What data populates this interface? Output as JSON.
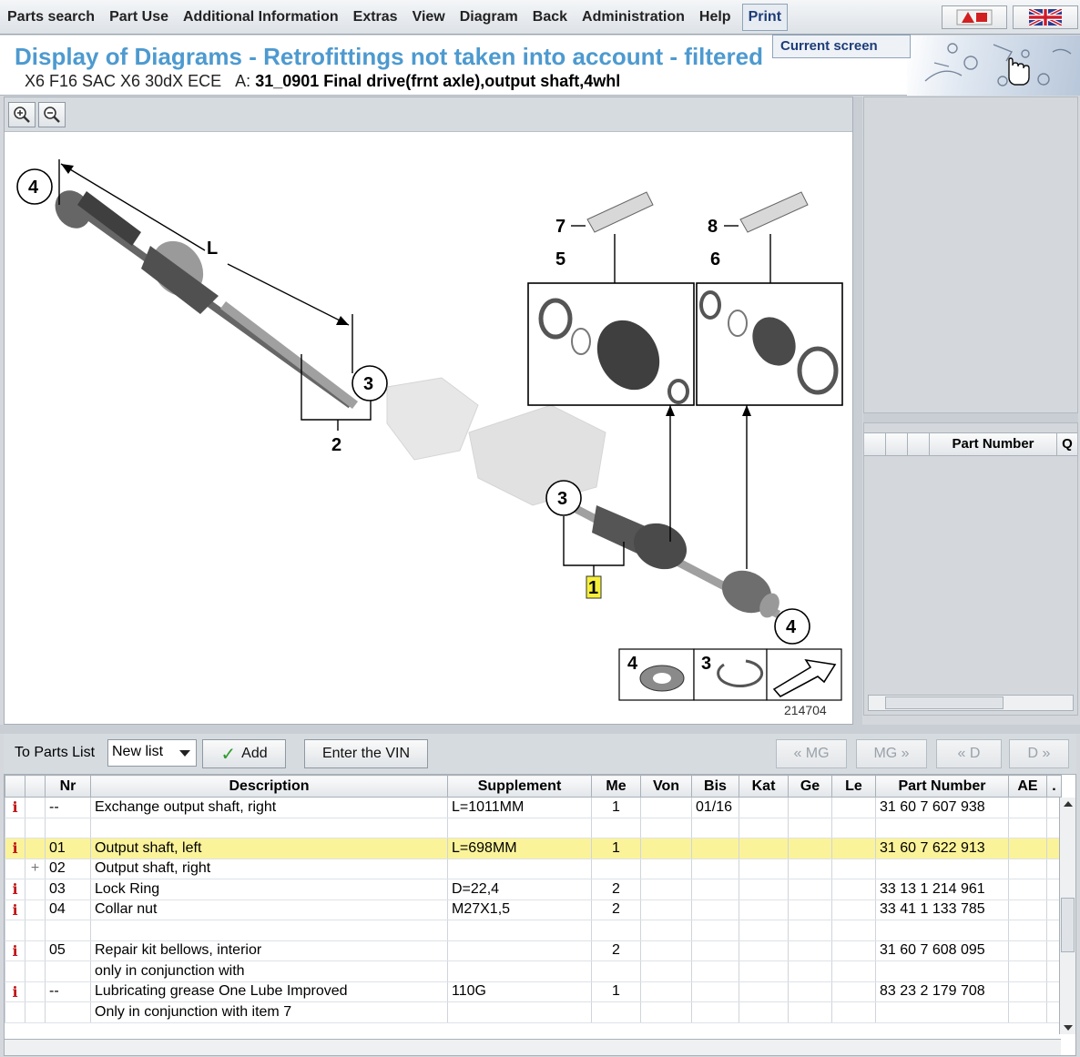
{
  "menu": {
    "items": [
      "Parts search",
      "Part Use",
      "Additional Information",
      "Extras",
      "View",
      "Diagram",
      "Back",
      "Administration",
      "Help"
    ],
    "print_label": "Print",
    "print_dropdown_item": "Current screen"
  },
  "header": {
    "title": "Display of Diagrams - Retrofittings not taken into account - filtered",
    "vehicle": "X6 F16 SAC X6 30dX ECE",
    "group_prefix": "A:",
    "group": "31_0901 Final drive(frnt axle),output shaft,4whl"
  },
  "diagram": {
    "image_number": "214704",
    "labels": {
      "dim_L": "L",
      "n1": "1",
      "n2": "2",
      "n3": "3",
      "n4": "4",
      "n5": "5",
      "n6": "6",
      "n7": "7",
      "n8": "8"
    }
  },
  "right_panel": {
    "columns": [
      "Part Number",
      "Q"
    ]
  },
  "actions": {
    "to_parts_list_label": "To Parts List",
    "list_select_value": "New list",
    "add_label": "Add",
    "enter_vin_label": "Enter the VIN",
    "prev_mg_label": "« MG",
    "next_mg_label": "MG »",
    "prev_d_label": "« D",
    "next_d_label": "D »"
  },
  "table": {
    "columns": [
      "",
      "",
      "Nr",
      "Description",
      "Supplement",
      "Me",
      "Von",
      "Bis",
      "Kat",
      "Ge",
      "Le",
      "Part Number",
      "AE",
      "."
    ],
    "rows": [
      {
        "info": "i",
        "mark": "",
        "nr": "--",
        "desc": "Exchange output shaft, right",
        "supp": "L=1011MM",
        "me": "1",
        "von": "",
        "bis": "01/16",
        "kat": "",
        "ge": "",
        "le": "",
        "pn": "31 60 7 607 938",
        "ae": "",
        "hl": false
      },
      {
        "info": "",
        "mark": "",
        "nr": "",
        "desc": "",
        "supp": "",
        "me": "",
        "von": "",
        "bis": "",
        "kat": "",
        "ge": "",
        "le": "",
        "pn": "",
        "ae": "",
        "hl": false
      },
      {
        "info": "i",
        "mark": "",
        "nr": "01",
        "desc": "Output shaft, left",
        "supp": "L=698MM",
        "me": "1",
        "von": "",
        "bis": "",
        "kat": "",
        "ge": "",
        "le": "",
        "pn": "31 60 7 622 913",
        "ae": "",
        "hl": true
      },
      {
        "info": "",
        "mark": "+",
        "nr": "02",
        "desc": "Output shaft, right",
        "supp": "",
        "me": "",
        "von": "",
        "bis": "",
        "kat": "",
        "ge": "",
        "le": "",
        "pn": "",
        "ae": "",
        "hl": false
      },
      {
        "info": "i",
        "mark": "",
        "nr": "03",
        "desc": "Lock Ring",
        "supp": "D=22,4",
        "me": "2",
        "von": "",
        "bis": "",
        "kat": "",
        "ge": "",
        "le": "",
        "pn": "33 13 1 214 961",
        "ae": "",
        "hl": false
      },
      {
        "info": "i",
        "mark": "",
        "nr": "04",
        "desc": "Collar nut",
        "supp": "M27X1,5",
        "me": "2",
        "von": "",
        "bis": "",
        "kat": "",
        "ge": "",
        "le": "",
        "pn": "33 41 1 133 785",
        "ae": "",
        "hl": false
      },
      {
        "info": "",
        "mark": "",
        "nr": "",
        "desc": "",
        "supp": "",
        "me": "",
        "von": "",
        "bis": "",
        "kat": "",
        "ge": "",
        "le": "",
        "pn": "",
        "ae": "",
        "hl": false
      },
      {
        "info": "i",
        "mark": "",
        "nr": "05",
        "desc": "Repair kit bellows, interior",
        "supp": "",
        "me": "2",
        "von": "",
        "bis": "",
        "kat": "",
        "ge": "",
        "le": "",
        "pn": "31 60 7 608 095",
        "ae": "",
        "hl": false
      },
      {
        "info": "",
        "mark": "",
        "nr": "",
        "desc": "only in conjunction with",
        "supp": "",
        "me": "",
        "von": "",
        "bis": "",
        "kat": "",
        "ge": "",
        "le": "",
        "pn": "",
        "ae": "",
        "hl": false
      },
      {
        "info": "i",
        "mark": "",
        "nr": "--",
        "desc": "Lubricating grease One Lube Improved",
        "supp": "110G",
        "me": "1",
        "von": "",
        "bis": "",
        "kat": "",
        "ge": "",
        "le": "",
        "pn": "83 23 2 179 708",
        "ae": "",
        "hl": false
      },
      {
        "info": "",
        "mark": "",
        "nr": "",
        "desc": "Only in conjunction with item 7",
        "supp": "",
        "me": "",
        "von": "",
        "bis": "",
        "kat": "",
        "ge": "",
        "le": "",
        "pn": "",
        "ae": "",
        "hl": false
      }
    ]
  },
  "colors": {
    "title_blue": "#4d9ad0",
    "highlight": "#fbf39a",
    "info_red": "#c01818"
  }
}
